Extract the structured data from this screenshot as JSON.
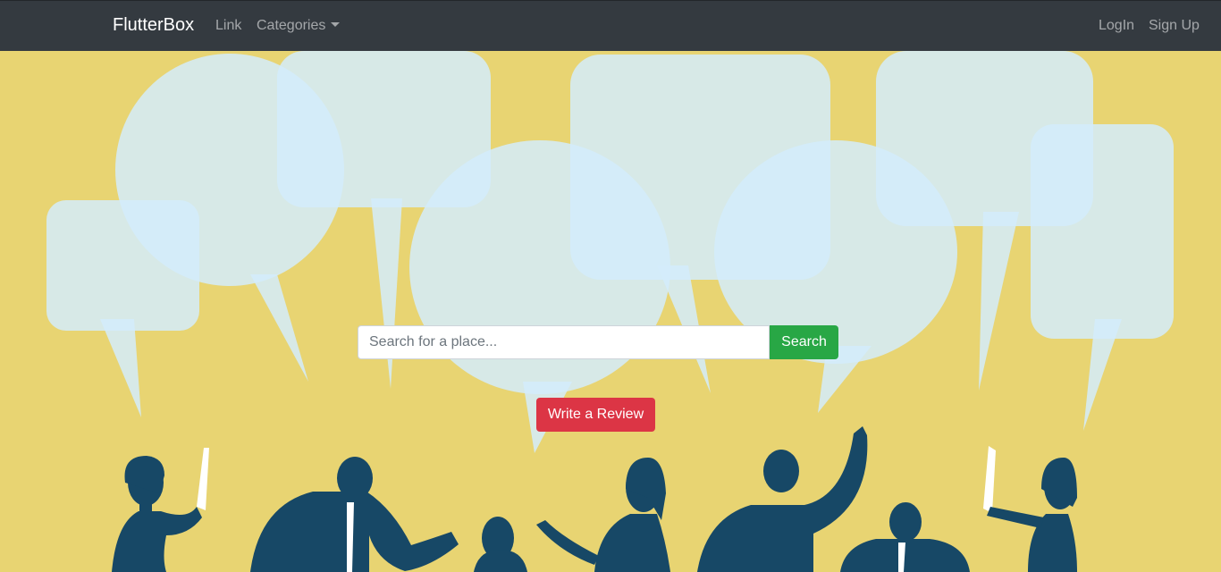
{
  "navbar": {
    "brand": "FlutterBox",
    "links": [
      "Link",
      "Categories"
    ],
    "right_links": [
      "LogIn",
      "Sign Up"
    ]
  },
  "hero": {
    "illustration": "speech-bubbles-and-people",
    "search": {
      "placeholder": "Search for a place...",
      "button_label": "Search"
    },
    "review_button_label": "Write a Review"
  },
  "colors": {
    "navbar_bg": "#343a40",
    "hero_bg": "#e8d472",
    "bubble": "#d6edfb",
    "people": "#174866",
    "search_button": "#28a745",
    "review_button": "#dc3545"
  }
}
